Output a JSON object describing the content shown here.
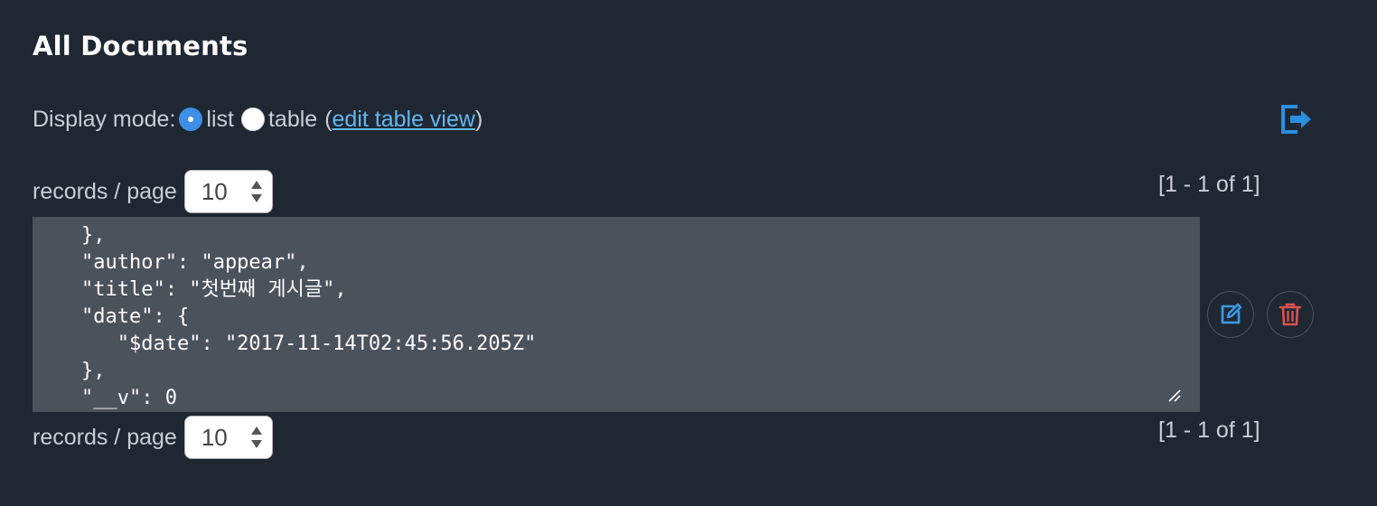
{
  "header": {
    "title": "All Documents"
  },
  "display_mode": {
    "label": "Display mode:",
    "option_list": "list",
    "option_table": "table",
    "paren_open": "(",
    "edit_link": "edit table view",
    "paren_close": ")",
    "selected": "list"
  },
  "pagination": {
    "records_label": "records / page",
    "per_page": "10",
    "range_text": "[1 - 1 of 1]"
  },
  "document": {
    "json_text": "},\n\"author\": \"appear\",\n\"title\": \"첫번째 게시글\",\n\"date\": {\n   \"$date\": \"2017-11-14T02:45:56.205Z\"\n},\n\"__v\": 0"
  },
  "icons": {
    "export": "export-icon",
    "edit": "edit-icon",
    "delete": "trash-icon",
    "resize": "resize-handle-icon",
    "stepper": "stepper-arrows-icon"
  },
  "colors": {
    "background": "#1f2733",
    "accent_blue": "#3d8fe8",
    "link": "#63b7f0",
    "delete_red": "#d9534f",
    "edit_blue": "#3c9ce6",
    "doc_background": "#4a525c"
  }
}
